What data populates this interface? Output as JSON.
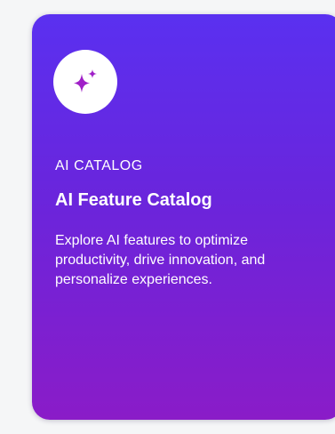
{
  "card": {
    "icon": "sparkles-icon",
    "eyebrow": "AI CATALOG",
    "title": "AI Feature Catalog",
    "description": "Explore AI features to optimize productivity, drive innovation, and personalize experiences.",
    "colors": {
      "gradient_top": "#5a30f0",
      "gradient_bottom": "#8a1cc8",
      "icon_color": "#a020c8",
      "text": "#ffffff"
    }
  }
}
